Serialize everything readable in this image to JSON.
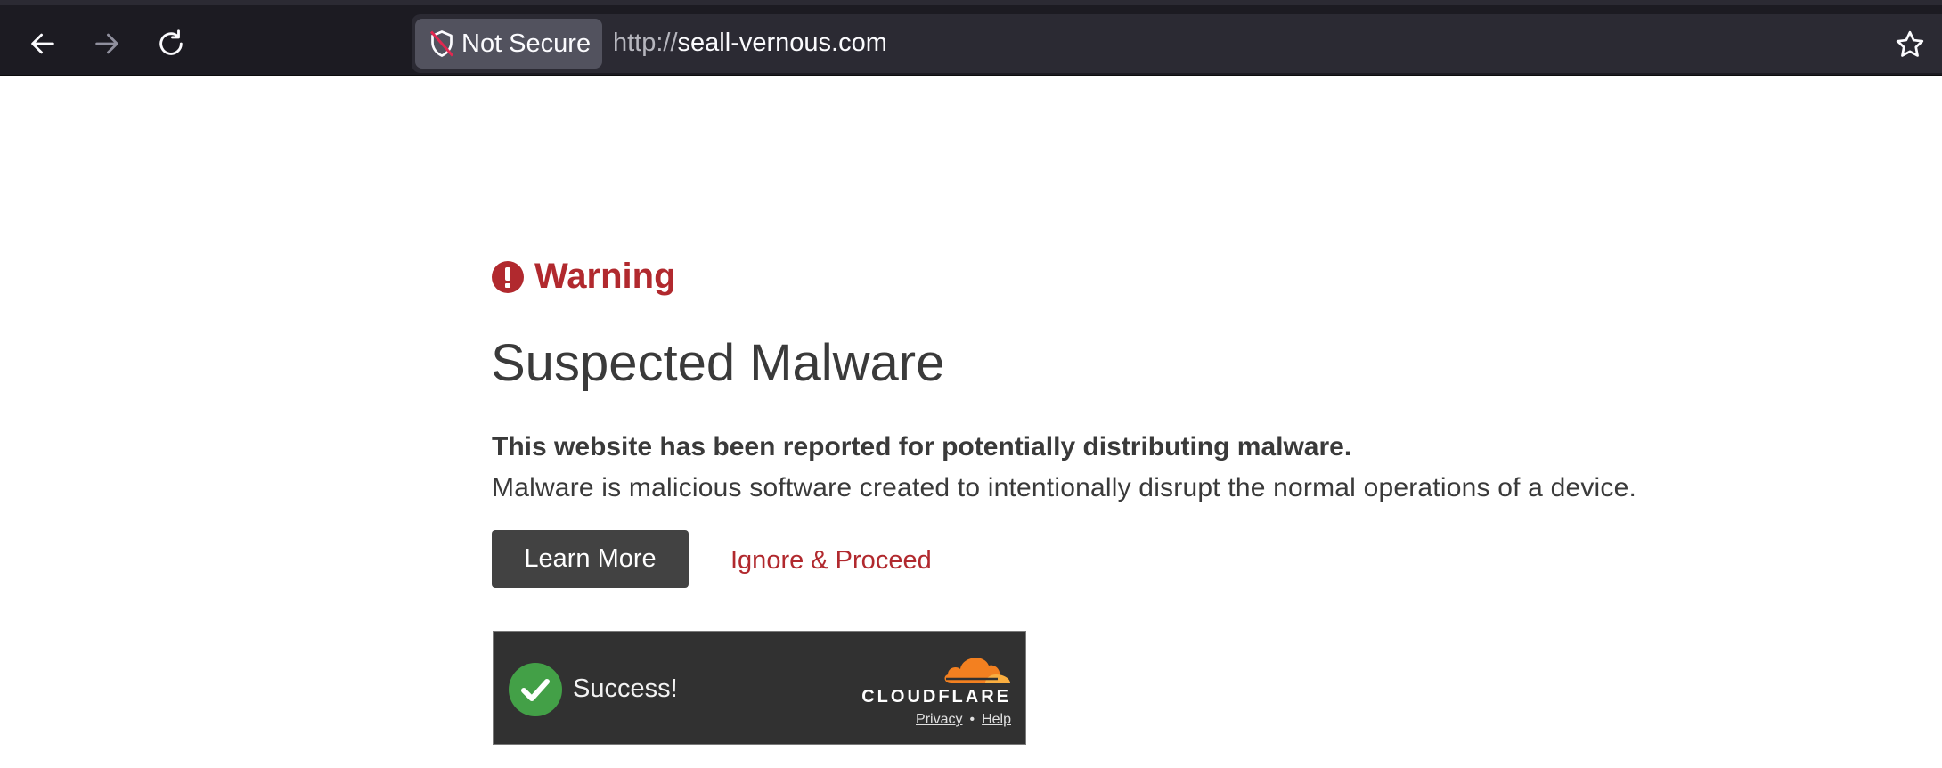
{
  "browser": {
    "security_label": "Not Secure",
    "url_scheme": "http://",
    "url_host": "seall-vernous.com",
    "icons": {
      "back": "arrow-left-icon",
      "forward": "arrow-right-icon",
      "reload": "reload-icon",
      "security": "shield-broken-icon",
      "bookmark": "star-icon"
    }
  },
  "page": {
    "warning_label": "Warning",
    "title": "Suspected Malware",
    "lead": "This website has been reported for potentially distributing malware.",
    "description": "Malware is malicious software created to intentionally disrupt the normal operations of a device.",
    "learn_more_label": "Learn More",
    "ignore_label": "Ignore & Proceed",
    "accent_color": "#b1292e"
  },
  "captcha_widget": {
    "status_text": "Success!",
    "brand": "CLOUDFLARE",
    "privacy_label": "Privacy",
    "separator": "•",
    "help_label": "Help",
    "check_color": "#43a047",
    "brand_color": "#f38020"
  }
}
